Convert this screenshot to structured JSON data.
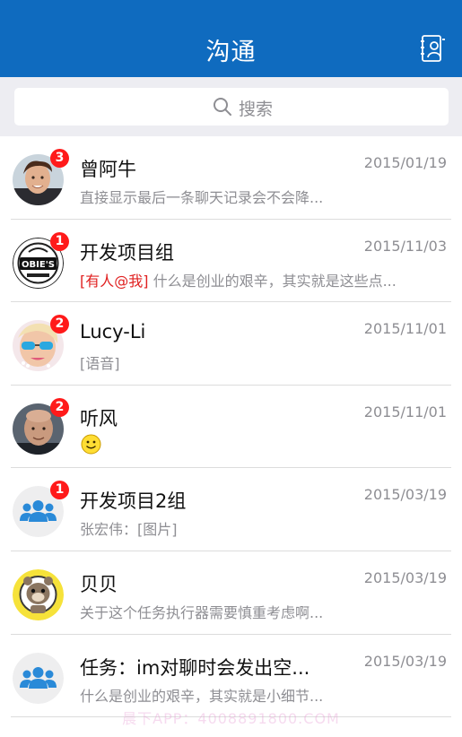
{
  "header": {
    "title": "沟通",
    "contacts_icon": "contacts-book-icon"
  },
  "search": {
    "placeholder": "搜索",
    "icon": "search-icon"
  },
  "colors": {
    "brand_blue": "#0f6bbf",
    "badge_red": "#ff1a1a",
    "mention_red": "#e02020",
    "secondary_text": "#8e8e93"
  },
  "conversations": [
    {
      "name": "曾阿牛",
      "time": "2015/01/19",
      "badge": "3",
      "preview": "直接显示最后一条聊天记录会不会降...",
      "avatar": "man-photo-avatar"
    },
    {
      "name": "开发项目组",
      "time": "2015/11/03",
      "badge": "1",
      "mention": "[有人@我]",
      "preview": " 什么是创业的艰辛，其实就是这些点...",
      "avatar": "obies-logo-avatar"
    },
    {
      "name": "Lucy-Li",
      "time": "2015/11/01",
      "badge": "2",
      "preview": "[语音]",
      "avatar": "woman-sunglasses-avatar"
    },
    {
      "name": "听风",
      "time": "2015/11/01",
      "badge": "2",
      "preview_icon": "smiley-emoji-icon",
      "avatar": "bald-man-avatar"
    },
    {
      "name": "开发项目2组",
      "time": "2015/03/19",
      "badge": "1",
      "preview": "张宏伟：[图片]",
      "avatar": "group-avatar"
    },
    {
      "name": "贝贝",
      "time": "2015/03/19",
      "preview": "关于这个任务执行器需要慎重考虑啊...",
      "avatar": "bear-avatar"
    },
    {
      "name": "任务：im对聊时会发出空...",
      "time": "2015/03/19",
      "preview": "什么是创业的艰辛，其实就是小细节...",
      "avatar": "group-avatar"
    }
  ],
  "watermark": "晨下APP：4008891800.COM"
}
